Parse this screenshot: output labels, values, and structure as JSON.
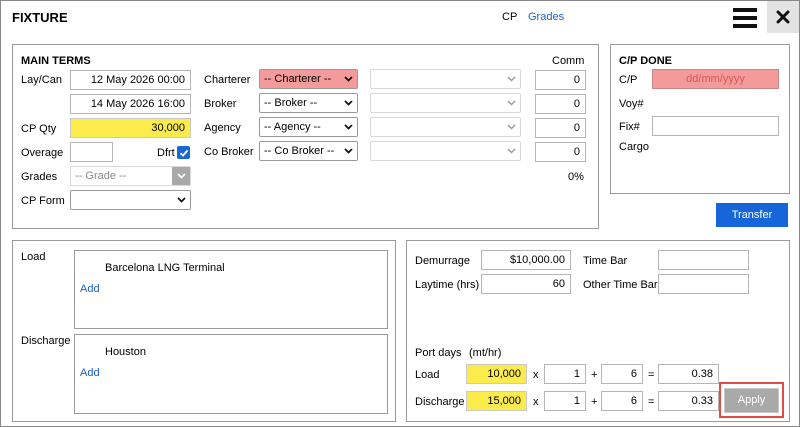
{
  "header": {
    "title": "FIXTURE",
    "links": [
      "CP",
      "Grades"
    ]
  },
  "main_terms": {
    "heading": "MAIN TERMS",
    "comm_label": "Comm",
    "laycan_label": "Lay/Can",
    "laycan_from": "12 May 2026 00:00",
    "laycan_to": "14 May 2026 16:00",
    "cpqty_label": "CP Qty",
    "cpqty_value": "30,000",
    "overage_label": "Overage",
    "dfrt_label": "Dfrt",
    "grades_label": "Grades",
    "grades_select": "-- Grade --",
    "cpform_label": "CP Form",
    "charterer_label": "Charterer",
    "charterer_select": "-- Charterer --",
    "broker_label": "Broker",
    "broker_select": "-- Broker --",
    "agency_label": "Agency",
    "agency_select": "-- Agency --",
    "cobroker_label": "Co Broker",
    "cobroker_select": "-- Co Broker --",
    "comm_values": [
      "0",
      "0",
      "0",
      "0"
    ],
    "comm_total": "0%"
  },
  "cp_done": {
    "heading": "C/P DONE",
    "cp_label": "C/P",
    "cp_placeholder": "dd/mm/yyyy",
    "voy_label": "Voy#",
    "fix_label": "Fix#",
    "cargo_label": "Cargo",
    "transfer_button": "Transfer"
  },
  "ports": {
    "load_label": "Load",
    "load_port": "Barcelona LNG Terminal",
    "load_add": "Add",
    "discharge_label": "Discharge",
    "discharge_port": "Houston",
    "discharge_add": "Add"
  },
  "terms": {
    "demurrage_label": "Demurrage",
    "demurrage_value": "$10,000.00",
    "laytime_label": "Laytime (hrs)",
    "laytime_value": "60",
    "timebar_label": "Time Bar",
    "othertimebar_label": "Other Time Bar",
    "portdays_label": "Port days",
    "portdays_unit": "(mt/hr)",
    "load_label": "Load",
    "load_rate": "10,000",
    "load_mult": "1",
    "load_add": "6",
    "load_result": "0.38",
    "discharge_label": "Discharge",
    "discharge_rate": "15,000",
    "discharge_mult": "1",
    "discharge_add": "6",
    "discharge_result": "0.33",
    "op_x": "x",
    "op_plus": "+",
    "op_eq": "=",
    "apply_button": "Apply"
  }
}
